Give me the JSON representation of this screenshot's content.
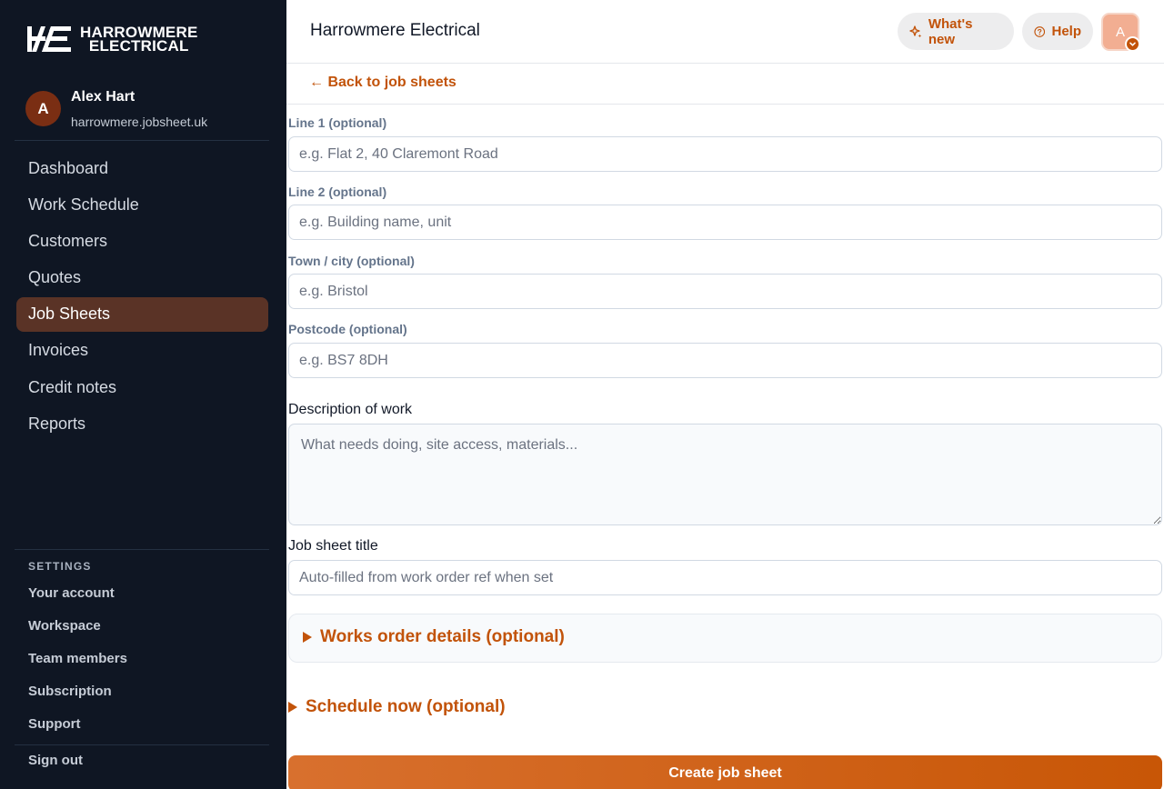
{
  "brand": {
    "logo_mark": "HE",
    "logo_line1": "HARROWMERE",
    "logo_line2": "ELECTRICAL",
    "accent": "#c2530a",
    "sidebar_bg": "#0f1623"
  },
  "user": {
    "initial": "A",
    "name": "Alex Hart",
    "site": "harrowmere.jobsheet.uk"
  },
  "nav": {
    "items": [
      {
        "label": "Dashboard"
      },
      {
        "label": "Work Schedule"
      },
      {
        "label": "Customers"
      },
      {
        "label": "Quotes"
      },
      {
        "label": "Job Sheets",
        "active": true
      },
      {
        "label": "Invoices"
      },
      {
        "label": "Credit notes"
      },
      {
        "label": "Reports"
      }
    ]
  },
  "settings": {
    "heading": "SETTINGS",
    "items": [
      {
        "label": "Your account"
      },
      {
        "label": "Workspace"
      },
      {
        "label": "Team members"
      },
      {
        "label": "Subscription"
      },
      {
        "label": "Support"
      }
    ],
    "sign_out": "Sign out"
  },
  "header": {
    "title": "Harrowmere Electrical",
    "whats_new": "What's new",
    "help": "Help",
    "avatar_initial": "A"
  },
  "back_link": "← Back to job sheets",
  "form": {
    "line1": {
      "label": "Line 1 (optional)",
      "placeholder": "e.g. Flat 2, 40 Claremont Road",
      "value": ""
    },
    "line2": {
      "label": "Line 2 (optional)",
      "placeholder": "e.g. Building name, unit",
      "value": ""
    },
    "town": {
      "label": "Town / city (optional)",
      "placeholder": "e.g. Bristol",
      "value": ""
    },
    "postcode": {
      "label": "Postcode (optional)",
      "placeholder": "e.g. BS7 8DH",
      "value": ""
    },
    "description": {
      "label": "Description of work",
      "placeholder": "What needs doing, site access, materials...",
      "value": ""
    },
    "title": {
      "label": "Job sheet title",
      "placeholder": "Auto-filled from work order ref when set",
      "value": ""
    },
    "works_order": "Works order details (optional)",
    "schedule": "Schedule now (optional)",
    "submit": "Create job sheet"
  }
}
